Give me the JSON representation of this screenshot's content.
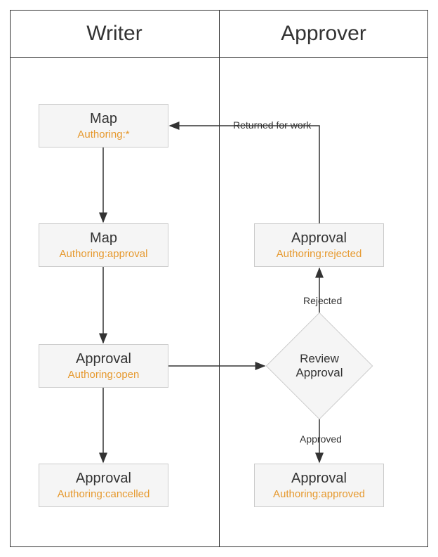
{
  "swimlanes": {
    "writer": "Writer",
    "approver": "Approver"
  },
  "nodes": {
    "map_authoring": {
      "title": "Map",
      "subtitle": "Authoring:*"
    },
    "map_approval": {
      "title": "Map",
      "subtitle": "Authoring:approval"
    },
    "approval_open": {
      "title": "Approval",
      "subtitle": "Authoring:open"
    },
    "approval_cancelled": {
      "title": "Approval",
      "subtitle": "Authoring:cancelled"
    },
    "review_approval": {
      "title": "Review\nApproval"
    },
    "approval_rejected": {
      "title": "Approval",
      "subtitle": "Authoring:rejected"
    },
    "approval_approved": {
      "title": "Approval",
      "subtitle": "Authoring:approved"
    }
  },
  "edges": {
    "returned": "Returned for work",
    "rejected": "Rejected",
    "approved": "Approved"
  }
}
